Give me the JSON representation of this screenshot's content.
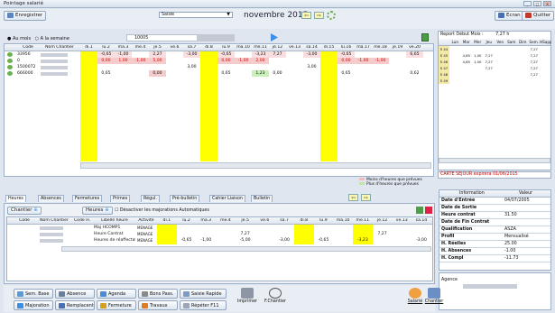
{
  "window": {
    "title": "Pointage salarié"
  },
  "toolbar": {
    "save_label": "Enregistrer",
    "site_select": "Saisie",
    "month": "novembre 2015",
    "ecran_label": "Ecran",
    "quitter_label": "Quitter"
  },
  "filters": {
    "au_mois": "Au mois",
    "a_la_semaine": "A la semaine",
    "code_filter": "10005"
  },
  "top_grid": {
    "headers": [
      "Code",
      "Nom Chantier",
      "di.1",
      "lu.2",
      "ma.3",
      "me.4",
      "je.5",
      "ve.6",
      "sa.7",
      "di.8",
      "lu.9",
      "ma.10",
      "me.11",
      "je.12",
      "ve.13",
      "sa.14",
      "di.15",
      "lu.16",
      "ma.17",
      "me.18",
      "je.19",
      "ve.20"
    ],
    "rows": [
      {
        "code": "33956",
        "name": "",
        "v": [
          "",
          "-0,65",
          "-1,00",
          "",
          "2,27",
          "",
          "-3,00",
          "",
          "-0,65",
          "",
          "-3,23",
          "7,27",
          "",
          "-3,00",
          "",
          "-0,65",
          "",
          "",
          "",
          "6,65"
        ]
      },
      {
        "code": "0",
        "name": "",
        "v": [
          "",
          "0,00",
          "1,00",
          "-1,00",
          "5,00",
          "",
          "",
          "",
          "0,00",
          "-1,00",
          "2,00",
          "",
          "",
          "",
          "",
          "0,00",
          "-1,00",
          "-1,00",
          "",
          ""
        ]
      },
      {
        "code": "1500072",
        "name": "",
        "v": [
          "",
          "",
          "",
          "",
          "",
          "",
          "3,00",
          "",
          "",
          "",
          "",
          "",
          "",
          "3,00",
          "",
          "",
          "",
          "",
          "",
          ""
        ]
      },
      {
        "code": "666000",
        "name": "",
        "v": [
          "",
          "0,65",
          "",
          "",
          "0,00",
          "",
          "",
          "",
          "0,65",
          "",
          "1,23",
          "0,00",
          "",
          "",
          "",
          "0,65",
          "",
          "",
          "",
          "0,62"
        ]
      }
    ]
  },
  "report": {
    "title": "Report Début Mois :",
    "value": "7,27 h",
    "days": [
      "Lun",
      "Mar",
      "Mer",
      "Jeu",
      "Ven",
      "Sam",
      "Dim",
      "Sem.",
      "HSapp"
    ],
    "rows": [
      {
        "label": "S 44",
        "vals": [
          "",
          "",
          "",
          "",
          "",
          "",
          "",
          "7,27",
          ""
        ]
      },
      {
        "label": "S 45",
        "vals": [
          "",
          "4,65",
          "1,00",
          "7,27",
          "",
          "",
          "",
          "7,27",
          ""
        ]
      },
      {
        "label": "S 46",
        "vals": [
          "",
          "4,65",
          "1,00",
          "7,27",
          "",
          "",
          "",
          "7,27",
          ""
        ]
      },
      {
        "label": "S 47",
        "vals": [
          "",
          "",
          "",
          "7,27",
          "",
          "",
          "",
          "7,27",
          ""
        ]
      },
      {
        "label": "S 48",
        "vals": [
          "",
          "",
          "",
          "",
          "",
          "",
          "",
          "7,27",
          ""
        ]
      },
      {
        "label": "S 49",
        "vals": [
          "",
          "",
          "",
          "",
          "",
          "",
          "",
          "",
          ""
        ]
      }
    ]
  },
  "legend": {
    "moins": "Moins d'heures que prévues",
    "plus": "Plus d'heures que prévues"
  },
  "carte_sejour": "CARTE SEJOUR expirera 01/06/2015",
  "tabs": [
    "Heures",
    "Absences",
    "Fermetures",
    "Primes",
    "Régul.",
    "Pré-bulletin",
    "Cahier Liaison",
    "Bulletin"
  ],
  "chantier_bar": {
    "chantier": "Chantier",
    "heures": "Heures",
    "desactiver": "Désactiver les majorations Automatiques"
  },
  "bottom_grid": {
    "headers": [
      "Code",
      "Nom Chantier",
      "Code H.",
      "Libellé heure",
      "Activité",
      "di.1",
      "lu.2",
      "ma.3",
      "me.4",
      "je.5",
      "ve.6",
      "sa.7",
      "di.8",
      "lu.9",
      "ma.10",
      "me.11",
      "je.12",
      "ve.13",
      "sa.14"
    ],
    "rows": [
      {
        "libelle": "Maj HCOMP1",
        "activite": "MENAGE",
        "v": [
          "",
          "",
          "",
          "",
          "",
          "",
          "",
          "",
          "",
          "",
          "",
          "",
          "",
          ""
        ]
      },
      {
        "libelle": "Heure Contrat",
        "activite": "MENAGE",
        "v": [
          "",
          "",
          "",
          "",
          "7,27",
          "",
          "",
          "",
          "",
          "",
          "",
          "7,27",
          "",
          ""
        ]
      },
      {
        "libelle": "Heures de réaffectation",
        "activite": "MENAGE",
        "v": [
          "",
          "-0,65",
          "-1,00",
          "",
          "-5,00",
          "",
          "-3,00",
          "",
          "-0,65",
          "",
          "-3,23",
          "",
          "",
          "-3,00"
        ]
      }
    ]
  },
  "info": {
    "headers": [
      "Information",
      "Valeur"
    ],
    "rows": [
      {
        "k": "Date d'Entrée",
        "v": "04/07/2005"
      },
      {
        "k": "Date de Sortie",
        "v": ""
      },
      {
        "k": "Heure contrat",
        "v": "31.50"
      },
      {
        "k": "Date de Fin Contrat",
        "v": ""
      },
      {
        "k": "Qualification",
        "v": "ASZA"
      },
      {
        "k": "Profil",
        "v": "Mensualisé"
      },
      {
        "k": "H. Réelles",
        "v": "25.00"
      },
      {
        "k": "H. Absences",
        "v": "-1.00"
      },
      {
        "k": "H. Compl",
        "v": "-11.73"
      }
    ],
    "agence_label": "Agence"
  },
  "actions": {
    "sem_base": "Sem. Base",
    "absence": "Absence",
    "agenda": "Agenda",
    "bons_pass": "Bons Pass.",
    "saisie_rapide": "Saisie Rapide",
    "majoration": "Majoration",
    "remplacent": "Remplacent",
    "fermeture": "Fermeture",
    "travaux": "Travaux",
    "repeter": "Répéter F11",
    "imprimer": "Imprimer",
    "fchantier": "F.Chantier",
    "salarie": "Salarié",
    "chantier": "Chantier"
  }
}
